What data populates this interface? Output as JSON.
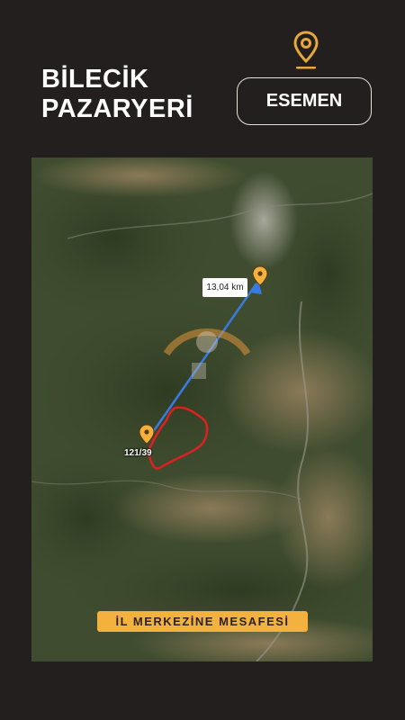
{
  "header": {
    "title_line1": "BİLECİK",
    "title_line2": "PAZARYERİ",
    "location_button_label": "ESEMEN",
    "location_icon": "map-pin-icon"
  },
  "map": {
    "distance_label": "13,04 km",
    "parcel_label": "121/39",
    "caption": "İL MERKEZİNE MESAFESİ",
    "colors": {
      "accent": "#f5b13d",
      "route_line": "#3a7be0",
      "parcel_outline": "#e02020",
      "background": "#231f1e"
    }
  }
}
